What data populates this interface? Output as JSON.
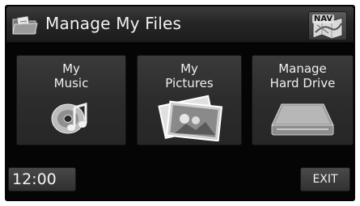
{
  "header": {
    "title": "Manage My Files",
    "icon": "folder-file-icon",
    "nav_label": "NAV"
  },
  "tiles": [
    {
      "label": "My\nMusic",
      "icon": "music-disc-icon"
    },
    {
      "label": "My\nPictures",
      "icon": "photos-icon"
    },
    {
      "label": "Manage\nHard Drive",
      "icon": "hard-drive-icon"
    }
  ],
  "footer": {
    "time": "12:00",
    "exit_label": "EXIT"
  }
}
